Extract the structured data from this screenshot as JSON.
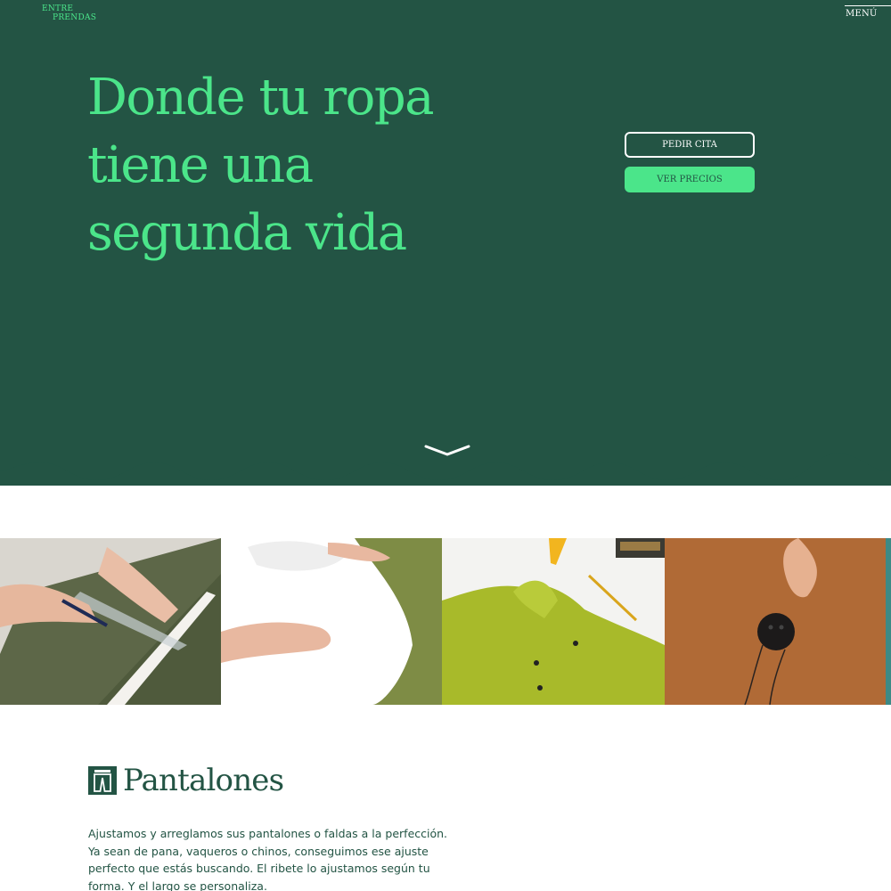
{
  "brand": {
    "logo_line1": "ENTRE",
    "logo_line2": "PRENDAS"
  },
  "nav": {
    "menu_label": "MENÚ"
  },
  "hero": {
    "headline": "Donde tu ropa tiene una segunda vida",
    "primary_cta": "PEDIR CITA",
    "secondary_cta": "VER PRECIOS",
    "scroll_icon": "chevron-down-icon"
  },
  "gallery": {
    "items": [
      {
        "name": "measuring-trousers-photo"
      },
      {
        "name": "white-dress-photo"
      },
      {
        "name": "green-shirt-photo"
      },
      {
        "name": "button-sewing-photo"
      }
    ]
  },
  "section": {
    "icon": "trousers-icon",
    "title": "Pantalones",
    "description": "Ajustamos y arreglamos sus pantalones o faldas a la perfección. Ya sean de pana, vaqueros o chinos, conseguimos ese ajuste perfecto que estás buscando. El ribete lo ajustamos según tu forma. Y el largo se personaliza."
  },
  "colors": {
    "brand_dark": "#235444",
    "brand_accent": "#4be58a",
    "background": "#ffffff"
  }
}
